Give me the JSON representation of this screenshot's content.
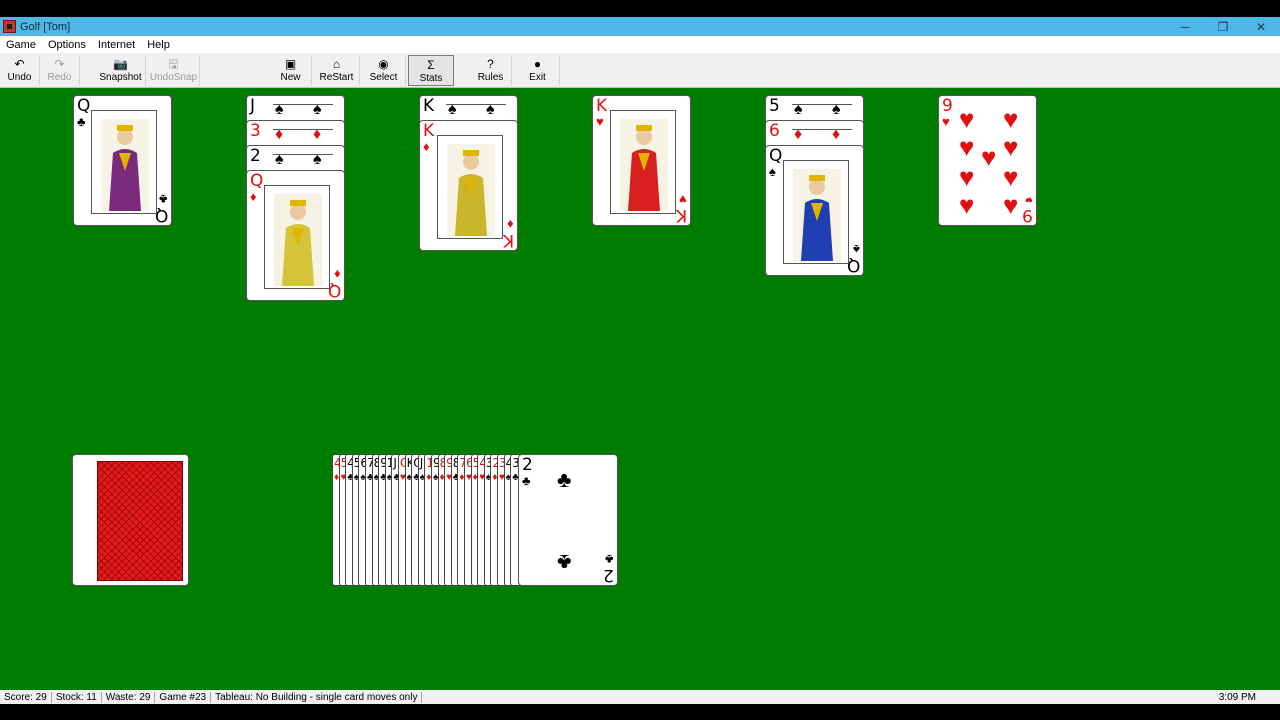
{
  "window": {
    "title": "Golf [Tom]",
    "controls": {
      "minimize": "─",
      "restore": "❐",
      "close": "✕"
    }
  },
  "menu": [
    "Game",
    "Options",
    "Internet",
    "Help"
  ],
  "toolbar": {
    "buttons": [
      {
        "label": "Undo",
        "icon": "undo-icon",
        "glyph": "↶",
        "enabled": true
      },
      {
        "label": "Redo",
        "icon": "redo-icon",
        "glyph": "↷",
        "enabled": false
      },
      {
        "label": "Snapshot",
        "icon": "camera-icon",
        "glyph": "📷",
        "enabled": true
      },
      {
        "label": "UndoSnap",
        "icon": "undo-snap-icon",
        "glyph": "🖫",
        "enabled": false
      },
      {
        "label": "New",
        "icon": "new-deck-icon",
        "glyph": "▣",
        "enabled": true
      },
      {
        "label": "ReStart",
        "icon": "home-icon",
        "glyph": "⌂",
        "enabled": true
      },
      {
        "label": "Select",
        "icon": "globe-icon",
        "glyph": "◉",
        "enabled": true
      },
      {
        "label": "Stats",
        "icon": "sigma-icon",
        "glyph": "Σ",
        "enabled": true,
        "pressed": true
      },
      {
        "label": "Rules",
        "icon": "help-icon",
        "glyph": "?",
        "enabled": true
      },
      {
        "label": "Exit",
        "icon": "exit-icon",
        "glyph": "●",
        "enabled": true
      }
    ]
  },
  "tableau": [
    {
      "covered": [],
      "top": {
        "rank": "Q",
        "suit": "♣",
        "color": "black",
        "court": true
      }
    },
    {
      "covered": [
        {
          "rank": "J",
          "suit": "♠",
          "color": "black"
        },
        {
          "rank": "3",
          "suit": "♦",
          "color": "red"
        },
        {
          "rank": "2",
          "suit": "♠",
          "color": "black"
        }
      ],
      "top": {
        "rank": "Q",
        "suit": "♦",
        "color": "red",
        "court": true
      }
    },
    {
      "covered": [
        {
          "rank": "K",
          "suit": "♠",
          "color": "black"
        }
      ],
      "top": {
        "rank": "K",
        "suit": "♦",
        "color": "red",
        "court": true
      }
    },
    {
      "covered": [],
      "top": {
        "rank": "K",
        "suit": "♥",
        "color": "red",
        "court": true
      }
    },
    {
      "covered": [
        {
          "rank": "5",
          "suit": "♠",
          "color": "black"
        },
        {
          "rank": "6",
          "suit": "♦",
          "color": "red"
        }
      ],
      "top": {
        "rank": "Q",
        "suit": "♠",
        "color": "black",
        "court": true
      }
    },
    {
      "covered": [],
      "top": {
        "rank": "9",
        "suit": "♥",
        "color": "red",
        "court": false
      }
    }
  ],
  "waste": {
    "fan": [
      {
        "rank": "4",
        "suit": "♦",
        "color": "red"
      },
      {
        "rank": "5",
        "suit": "♥",
        "color": "red"
      },
      {
        "rank": "4",
        "suit": "♣",
        "color": "black"
      },
      {
        "rank": "5",
        "suit": "♠",
        "color": "black"
      },
      {
        "rank": "6",
        "suit": "♠",
        "color": "black"
      },
      {
        "rank": "7",
        "suit": "♣",
        "color": "black"
      },
      {
        "rank": "8",
        "suit": "♠",
        "color": "black"
      },
      {
        "rank": "9",
        "suit": "♣",
        "color": "black"
      },
      {
        "rank": "10",
        "suit": "♠",
        "color": "black"
      },
      {
        "rank": "J",
        "suit": "♣",
        "color": "black"
      },
      {
        "rank": "Q",
        "suit": "♥",
        "color": "red"
      },
      {
        "rank": "K",
        "suit": "♠",
        "color": "black"
      },
      {
        "rank": "Q",
        "suit": "♣",
        "color": "black"
      },
      {
        "rank": "J",
        "suit": "♠",
        "color": "black"
      },
      {
        "rank": "10",
        "suit": "♦",
        "color": "red"
      },
      {
        "rank": "9",
        "suit": "♠",
        "color": "black"
      },
      {
        "rank": "8",
        "suit": "♦",
        "color": "red"
      },
      {
        "rank": "9",
        "suit": "♥",
        "color": "red"
      },
      {
        "rank": "8",
        "suit": "♣",
        "color": "black"
      },
      {
        "rank": "7",
        "suit": "♦",
        "color": "red"
      },
      {
        "rank": "6",
        "suit": "♥",
        "color": "red"
      },
      {
        "rank": "5",
        "suit": "♦",
        "color": "red"
      },
      {
        "rank": "4",
        "suit": "♥",
        "color": "red"
      },
      {
        "rank": "3",
        "suit": "♠",
        "color": "black"
      },
      {
        "rank": "2",
        "suit": "♦",
        "color": "red"
      },
      {
        "rank": "3",
        "suit": "♥",
        "color": "red"
      },
      {
        "rank": "4",
        "suit": "♠",
        "color": "black"
      },
      {
        "rank": "3",
        "suit": "♣",
        "color": "black"
      }
    ],
    "top": {
      "rank": "2",
      "suit": "♣",
      "color": "black"
    }
  },
  "status": {
    "score": "Score:  29",
    "stock": "Stock: 11",
    "waste": "Waste: 29",
    "game": "Game #23",
    "rule": "Tableau: No Building - single card moves only",
    "clock": "3:09 PM"
  }
}
